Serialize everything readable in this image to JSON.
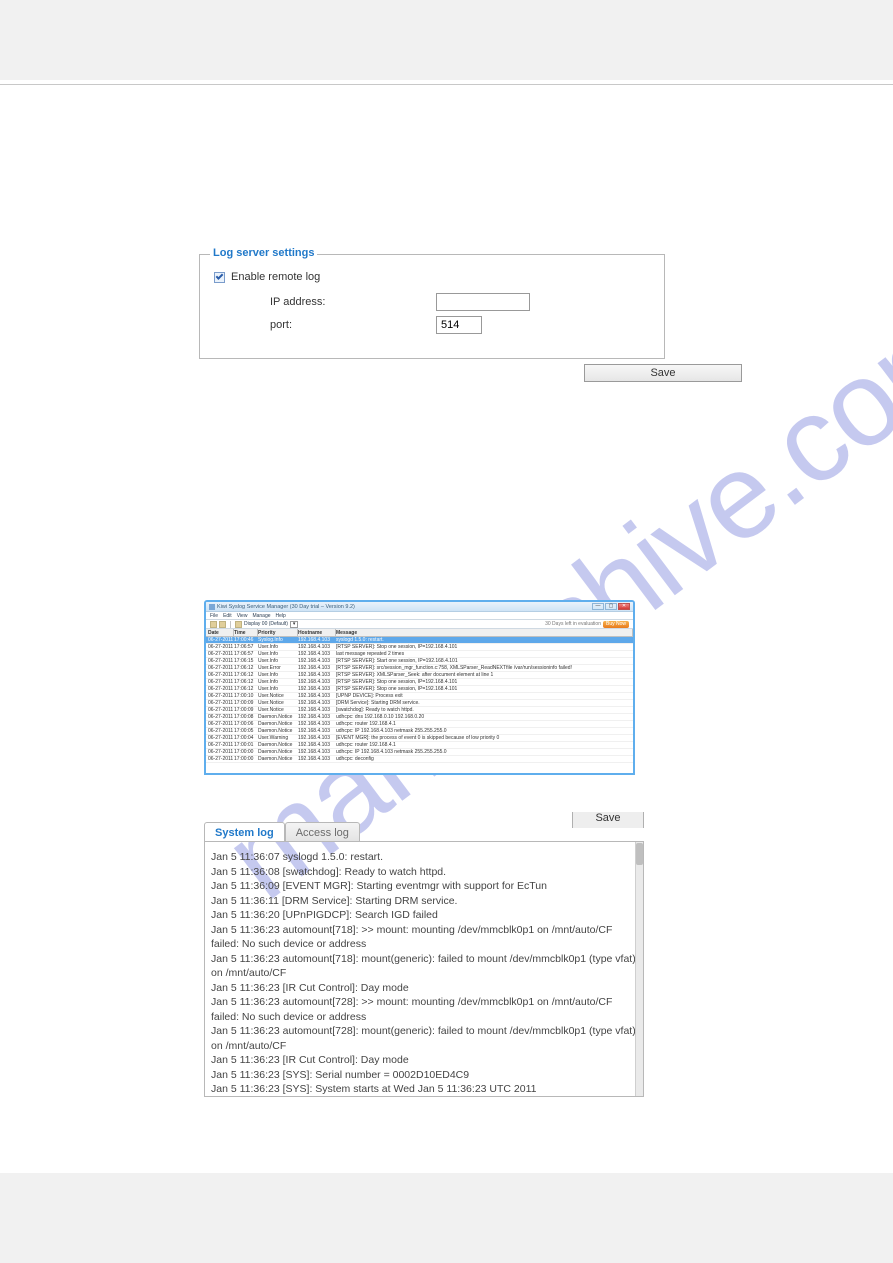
{
  "log_server": {
    "legend": "Log server settings",
    "enable_label": "Enable remote log",
    "ip_label": "IP address:",
    "ip_value": "",
    "port_label": "port:",
    "port_value": "514",
    "save": "Save"
  },
  "watermark": "manualshive.com",
  "syslog_app": {
    "title": "Kiwi Syslog Service Manager (30 Day trial – Version 9.2)",
    "menus": [
      "File",
      "Edit",
      "View",
      "Manage",
      "Help"
    ],
    "display_label": "Display 00 (Default)",
    "eval_text": "30 Days left in evaluation",
    "buy_label": "Buy Now",
    "headers": {
      "date": "Date",
      "time": "Time",
      "priority": "Priority",
      "hostname": "Hostname",
      "message": "Message"
    },
    "rows": [
      {
        "date": "06-27-2011",
        "time": "17:00:46",
        "pri": "Syslog.Info",
        "host": "192.168.4.103",
        "msg": "syslogd 1.5.0: restart.",
        "hl": true
      },
      {
        "date": "06-27-2011",
        "time": "17:06:57",
        "pri": "User.Info",
        "host": "192.168.4.103",
        "msg": "[RTSP SERVER]: Stop one session, IP=192.168.4.101"
      },
      {
        "date": "06-27-2011",
        "time": "17:06:57",
        "pri": "User.Info",
        "host": "192.168.4.103",
        "msg": "last message repeated 2 times"
      },
      {
        "date": "06-27-2011",
        "time": "17:06:15",
        "pri": "User.Info",
        "host": "192.168.4.103",
        "msg": "[RTSP SERVER]: Start one session, IP=192.168.4.101"
      },
      {
        "date": "06-27-2011",
        "time": "17:06:12",
        "pri": "User.Error",
        "host": "192.168.4.103",
        "msg": "[RTSP SERVER]: src/session_mgr_function.c:758, XMLSParser_ReadNEXTfile /var/run/sessioninfo failed!"
      },
      {
        "date": "06-27-2011",
        "time": "17:06:12",
        "pri": "User.Info",
        "host": "192.168.4.103",
        "msg": "[RTSP SERVER]: XMLSParser_Seek: after document element at line 1"
      },
      {
        "date": "06-27-2011",
        "time": "17:06:12",
        "pri": "User.Info",
        "host": "192.168.4.103",
        "msg": "[RTSP SERVER]: Stop one session, IP=192.168.4.101"
      },
      {
        "date": "06-27-2011",
        "time": "17:06:12",
        "pri": "User.Info",
        "host": "192.168.4.103",
        "msg": "[RTSP SERVER]: Stop one session, IP=192.168.4.101"
      },
      {
        "date": "06-27-2011",
        "time": "17:00:10",
        "pri": "User.Notice",
        "host": "192.168.4.103",
        "msg": "[UPNP DEVICE]: Process exit"
      },
      {
        "date": "06-27-2011",
        "time": "17:00:09",
        "pri": "User.Notice",
        "host": "192.168.4.103",
        "msg": "[DRM Service]: Starting DRM service."
      },
      {
        "date": "06-27-2011",
        "time": "17:00:09",
        "pri": "User.Notice",
        "host": "192.168.4.103",
        "msg": "[swatchdog]: Ready to watch httpd."
      },
      {
        "date": "06-27-2011",
        "time": "17:00:08",
        "pri": "Daemon.Notice",
        "host": "192.168.4.103",
        "msg": "udhcpc: dns 192.168.0.10 192.168.0.20"
      },
      {
        "date": "06-27-2011",
        "time": "17:00:06",
        "pri": "Daemon.Notice",
        "host": "192.168.4.103",
        "msg": "udhcpc: router 192.168.4.1"
      },
      {
        "date": "06-27-2011",
        "time": "17:00:05",
        "pri": "Daemon.Notice",
        "host": "192.168.4.103",
        "msg": "udhcpc: IP 192.168.4.103 netmask 255.255.255.0"
      },
      {
        "date": "06-27-2011",
        "time": "17:00:04",
        "pri": "User.Warning",
        "host": "192.168.4.103",
        "msg": "[EVENT MGR]: the process of event 0 is skipped because of low priority 0"
      },
      {
        "date": "06-27-2011",
        "time": "17:00:01",
        "pri": "Daemon.Notice",
        "host": "192.168.4.103",
        "msg": "udhcpc: router 192.168.4.1"
      },
      {
        "date": "06-27-2011",
        "time": "17:00:00",
        "pri": "Daemon.Notice",
        "host": "192.168.4.103",
        "msg": "udhcpc: IP 192.168.4.103 netmask 255.255.255.0"
      },
      {
        "date": "06-27-2011",
        "time": "17:00:00",
        "pri": "Daemon.Notice",
        "host": "192.168.4.103",
        "msg": "udhcpc: deconfig"
      }
    ]
  },
  "log_viewer": {
    "save": "Save",
    "tab_system": "System log",
    "tab_access": "Access log",
    "lines": [
      "Jan 5 11:36:07 syslogd 1.5.0: restart.",
      "Jan 5 11:36:08 [swatchdog]: Ready to watch httpd.",
      "Jan 5 11:36:09 [EVENT MGR]: Starting eventmgr with support for EcTun",
      "Jan 5 11:36:11 [DRM Service]: Starting DRM service.",
      "Jan 5 11:36:20 [UPnPIGDCP]: Search IGD failed",
      "Jan 5 11:36:23 automount[718]: >> mount: mounting /dev/mmcblk0p1 on /mnt/auto/CF failed: No such device or address",
      "Jan 5 11:36:23 automount[718]: mount(generic): failed to mount /dev/mmcblk0p1 (type vfat) on /mnt/auto/CF",
      "Jan 5 11:36:23 [IR Cut Control]: Day mode",
      "Jan 5 11:36:23 automount[728]: >> mount: mounting /dev/mmcblk0p1 on /mnt/auto/CF failed: No such device or address",
      "Jan 5 11:36:23 automount[728]: mount(generic): failed to mount /dev/mmcblk0p1 (type vfat) on /mnt/auto/CF",
      "Jan 5 11:36:23 [IR Cut Control]: Day mode",
      "Jan 5 11:36:23 [SYS]: Serial number = 0002D10ED4C9",
      "Jan 5 11:36:23 [SYS]: System starts at Wed Jan 5 11:36:23 UTC 2011"
    ]
  }
}
